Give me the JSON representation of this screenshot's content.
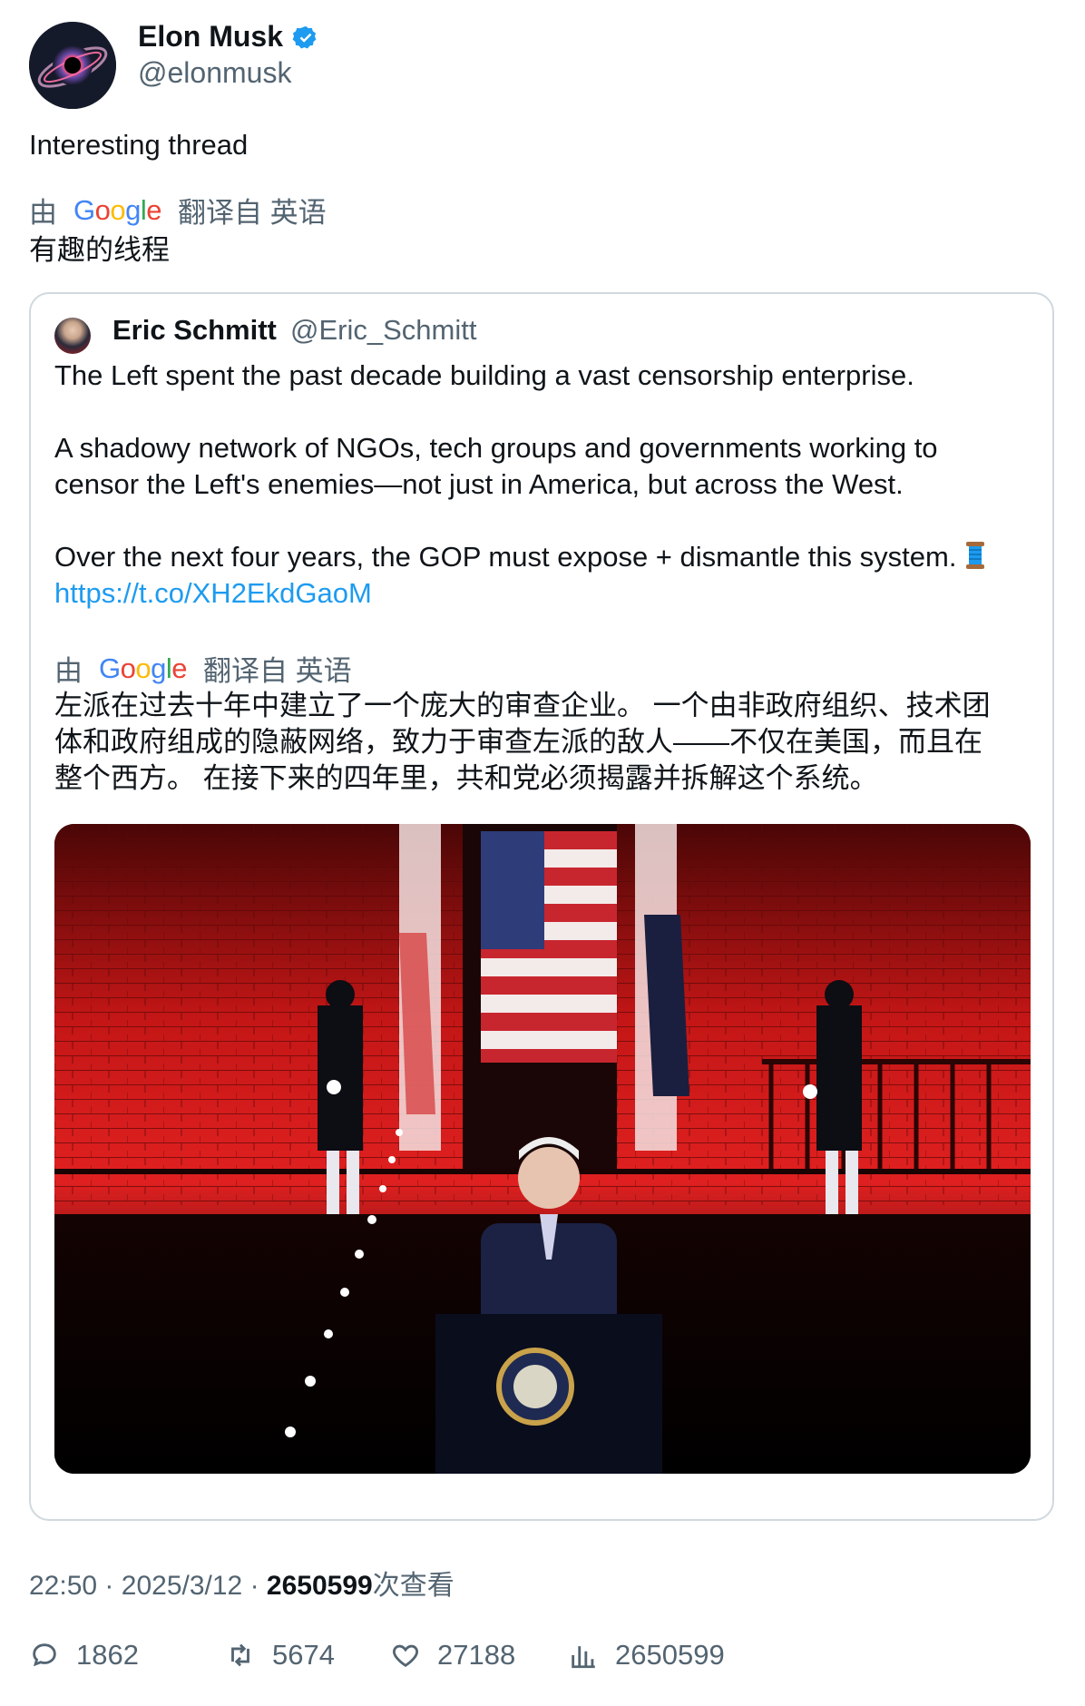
{
  "author": {
    "name": "Elon Musk",
    "handle": "@elonmusk",
    "verified": true
  },
  "tweet": {
    "text": "Interesting thread",
    "translation": {
      "prefix": "由",
      "provider_letters": [
        "G",
        "o",
        "o",
        "g",
        "l",
        "e"
      ],
      "suffix": "翻译自 英语",
      "text": "有趣的线程"
    }
  },
  "quote": {
    "author_name": "Eric Schmitt",
    "author_handle": "@Eric_Schmitt",
    "paragraph1": "The Left spent the past decade building a vast censorship enterprise.",
    "paragraph2_line1": "A shadowy network of NGOs, tech groups and governments working to",
    "paragraph2_line2": "censor the Left's enemies—not just in America, but across the West.",
    "paragraph3": "Over the next four years, the GOP must expose + dismantle this system.",
    "emoji_name": "spool-of-thread-icon",
    "link": "https://t.co/XH2EkdGaoM",
    "translation": {
      "prefix": "由",
      "suffix": "翻译自 英语",
      "line1": "左派在过去十年中建立了一个庞大的审查企业。 一个由非政府组织、技术团",
      "line2": "体和政府组成的隐蔽网络，致力于审查左派的敌人——不仅在美国，而且在",
      "line3": "整个西方。 在接下来的四年里，共和党必须揭露并拆解这个系统。"
    },
    "image_name": "speech-photo"
  },
  "meta": {
    "time": "22:50",
    "sep1": "·",
    "date": "2025/3/12",
    "sep2": "·",
    "views": "2650599",
    "views_suffix": "次查看"
  },
  "actions": {
    "replies": "1862",
    "reposts": "5674",
    "likes": "27188",
    "views": "2650599"
  },
  "colors": {
    "link": "#1d9bf0",
    "secondary_text": "#536471",
    "verified": "#1d9bf0",
    "border": "#cfd9de"
  }
}
